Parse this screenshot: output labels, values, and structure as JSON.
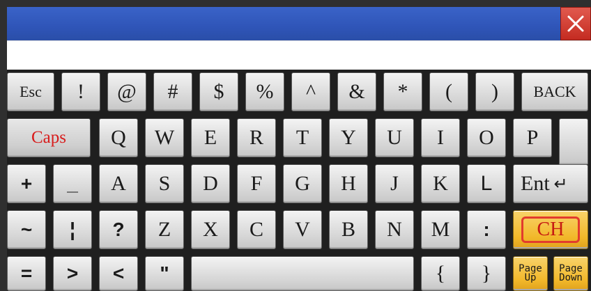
{
  "window": {
    "close_glyph": "✕"
  },
  "input": {
    "value": ""
  },
  "keyboard": {
    "row1": [
      "Esc",
      "!",
      "@",
      "#",
      "$",
      "%",
      "^",
      "&",
      "*",
      "(",
      ")",
      "BACK"
    ],
    "row2": [
      "Caps",
      "Q",
      "W",
      "E",
      "R",
      "T",
      "Y",
      "U",
      "I",
      "O",
      "P"
    ],
    "row3": [
      "+",
      "_",
      "A",
      "S",
      "D",
      "F",
      "G",
      "H",
      "J",
      "K",
      "L",
      "Ent"
    ],
    "row4": [
      "~",
      "¦",
      "?",
      "Z",
      "X",
      "C",
      "V",
      "B",
      "N",
      "M",
      ":",
      "CH"
    ],
    "row5": [
      "=",
      ">",
      "<",
      "\"",
      "",
      "{",
      "}",
      "Page Up",
      "Page Down"
    ],
    "ent_arrow_glyph": "↵",
    "page_up": "Page\nUp",
    "page_down": "Page\nDown"
  },
  "colors": {
    "title_bar": "#2f55b8",
    "close_button": "#c32a20",
    "caps_text": "#d81c1c",
    "ch_key": "#f2b82a",
    "ch_outline": "#e23b2d"
  }
}
